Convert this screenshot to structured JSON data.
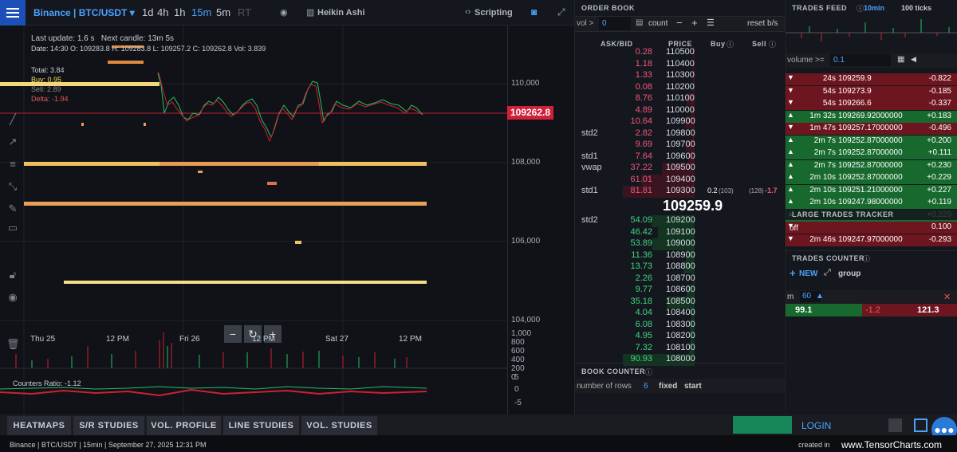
{
  "topbar": {
    "symbol": "Binance | BTC/USDT",
    "timeframes": [
      "1d",
      "4h",
      "1h",
      "15m",
      "5m",
      "RT"
    ],
    "active_timeframe": "15m",
    "chart_type": "Heikin Ashi",
    "scripting": "Scripting"
  },
  "info": {
    "last_update": "Last update: 1.6 s",
    "next_candle_label": "Next candle:",
    "next_candle": "13m 5s",
    "date_line": "Date: 14:30  O: 109283.8  H: 109283.8  L: 109257.2  C: 109262.8  Vol: 3.839",
    "total": "Total: 3.84",
    "buy": "Buy: 0.95",
    "sell": "Sell: 2.89",
    "delta": "Delta: -1.94",
    "counters_ratio": "Counters Ratio: -1.12"
  },
  "price_axis": {
    "labels": [
      "110,000",
      "108,000",
      "106,000",
      "104,000"
    ],
    "last_price": "109262.8",
    "volume_labels": [
      "1,000",
      "800",
      "600",
      "400",
      "200",
      "0"
    ],
    "ratio_labels": [
      "5",
      "0",
      "-5"
    ]
  },
  "time_axis": [
    "Thu 25",
    "12 PM",
    "Fri 26",
    "12 PM",
    "Sat 27",
    "12 PM"
  ],
  "bottom_tabs": [
    "HEATMAPS",
    "S/R STUDIES",
    "VOL. PROFILE",
    "LINE STUDIES",
    "VOL. STUDIES"
  ],
  "login": "LOGIN",
  "footer": {
    "left": "Binance | BTC/USDT | 15min | September 27, 2025 12:31 PM",
    "created": "created in",
    "brand": "www.TensorCharts.com"
  },
  "orderbook": {
    "title": "ORDER BOOK",
    "vol_label": "vol >",
    "vol_value": "0",
    "count": "count",
    "reset": "reset b/s",
    "headers": [
      "ASK/BID",
      "PRICE",
      "Buy",
      "Sell"
    ],
    "asks": [
      {
        "qty": "0.28",
        "price": "110500",
        "label": ""
      },
      {
        "qty": "1.18",
        "price": "110400",
        "label": ""
      },
      {
        "qty": "1.33",
        "price": "110300",
        "label": ""
      },
      {
        "qty": "0.08",
        "price": "110200",
        "label": ""
      },
      {
        "qty": "8.76",
        "price": "110100",
        "label": ""
      },
      {
        "qty": "4.89",
        "price": "110000",
        "label": ""
      },
      {
        "qty": "10.64",
        "price": "109900",
        "label": ""
      },
      {
        "qty": "2.82",
        "price": "109800",
        "label": "std2"
      },
      {
        "qty": "9.69",
        "price": "109700",
        "label": ""
      },
      {
        "qty": "7.64",
        "price": "109600",
        "label": "std1"
      },
      {
        "qty": "37.22",
        "price": "109500",
        "label": "vwap"
      },
      {
        "qty": "61.01",
        "price": "109400",
        "label": ""
      },
      {
        "qty": "81.81",
        "price": "109300",
        "label": "std1",
        "buy": "0.2",
        "buy_count": "(103)",
        "sell_count": "(128)",
        "sell": "-1.7"
      }
    ],
    "mid_price": "109259.9",
    "bids": [
      {
        "qty": "54.09",
        "price": "109200",
        "label": "std2"
      },
      {
        "qty": "46.42",
        "price": "109100",
        "label": ""
      },
      {
        "qty": "53.89",
        "price": "109000",
        "label": ""
      },
      {
        "qty": "11.36",
        "price": "108900",
        "label": ""
      },
      {
        "qty": "13.73",
        "price": "108800",
        "label": ""
      },
      {
        "qty": "2.26",
        "price": "108700",
        "label": ""
      },
      {
        "qty": "9.77",
        "price": "108600",
        "label": ""
      },
      {
        "qty": "35.18",
        "price": "108500",
        "label": ""
      },
      {
        "qty": "4.04",
        "price": "108400",
        "label": ""
      },
      {
        "qty": "6.08",
        "price": "108300",
        "label": ""
      },
      {
        "qty": "4.95",
        "price": "108200",
        "label": ""
      },
      {
        "qty": "7.32",
        "price": "108100",
        "label": ""
      },
      {
        "qty": "90.93",
        "price": "108000",
        "label": ""
      }
    ],
    "book_counter": "BOOK COUNTER",
    "number_of_rows_label": "number of rows",
    "number_of_rows": "6",
    "fixed": "fixed",
    "start": "start"
  },
  "trades_feed": {
    "title": "TRADES FEED",
    "tab_10min": "10min",
    "tab_100ticks": "100 ticks",
    "volume_label": "volume >=",
    "volume_value": "0.1",
    "rows": [
      {
        "time": "24s",
        "price": "109259.9",
        "qty": "-0.822",
        "side": "sell"
      },
      {
        "time": "54s",
        "price": "109273.9",
        "qty": "-0.185",
        "side": "sell"
      },
      {
        "time": "54s",
        "price": "109266.6",
        "qty": "-0.337",
        "side": "sell"
      },
      {
        "time": "1m 32s",
        "price": "109269.92000000",
        "qty": "+0.183",
        "side": "buy"
      },
      {
        "time": "1m 47s",
        "price": "109257.17000000",
        "qty": "-0.496",
        "side": "sell"
      },
      {
        "time": "2m 7s",
        "price": "109252.87000000",
        "qty": "+0.200",
        "side": "buy"
      },
      {
        "time": "2m 7s",
        "price": "109252.87000000",
        "qty": "+0.111",
        "side": "buy"
      },
      {
        "time": "2m 7s",
        "price": "109252.87000000",
        "qty": "+0.230",
        "side": "buy"
      },
      {
        "time": "2m 10s",
        "price": "109252.87000000",
        "qty": "+0.229",
        "side": "buy"
      },
      {
        "time": "2m 10s",
        "price": "109251.21000000",
        "qty": "+0.227",
        "side": "buy"
      },
      {
        "time": "2m 10s",
        "price": "109247.98000000",
        "qty": "+0.119",
        "side": "buy"
      },
      {
        "time": "",
        "price": "",
        "qty": "+0.229",
        "side": "buy"
      },
      {
        "time": "",
        "price": "",
        "qty": "0.100",
        "side": "sell"
      },
      {
        "time": "2m 46s",
        "price": "109247.97000000",
        "qty": "-0.293",
        "side": "sell"
      }
    ],
    "large_trades": "LARGE TRADES TRACKER",
    "off": "off",
    "trades_counter": "TRADES COUNTER",
    "new": "NEW",
    "group": "group",
    "counter_m": "m",
    "counter_val": "60",
    "counter_buy": "99.1",
    "counter_delta": "-1.2",
    "counter_sell": "121.3"
  }
}
